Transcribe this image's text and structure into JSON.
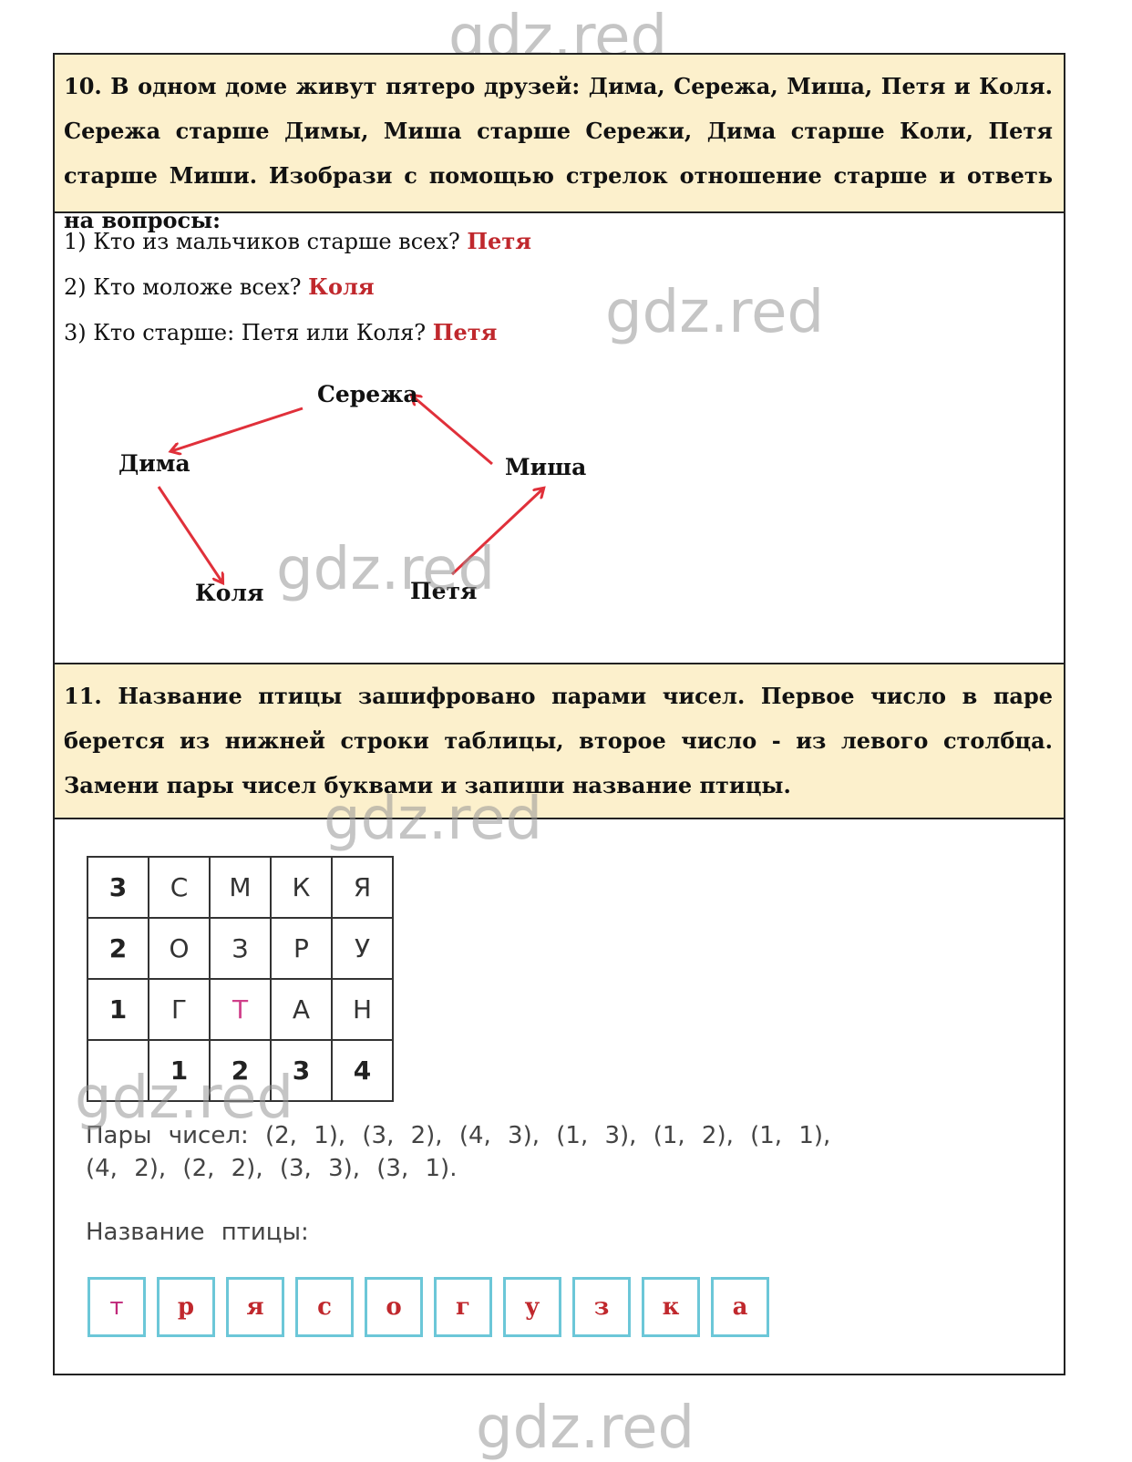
{
  "watermark": "gdz.red",
  "task10": {
    "text": "10. В одном доме живут пятеро друзей: Дима, Сережа, Миша, Петя и Коля. Сережа старше Димы, Миша старше Сережи, Дима старше Коли, Петя старше Миши. Изобрази с помощью стрелок отношение старше и ответь на вопросы:",
    "questions": [
      {
        "q": "1) Кто из мальчиков старше всех?",
        "a": "Петя"
      },
      {
        "q": "2) Кто моложе всех?",
        "a": "Коля"
      },
      {
        "q": "3) Кто старше: Петя или Коля?",
        "a": "Петя"
      }
    ],
    "diagram": {
      "nodes": [
        "Сережа",
        "Дима",
        "Миша",
        "Коля",
        "Петя"
      ],
      "arrow_color": "#e0303a",
      "edges": [
        [
          "Сережа",
          "Дима"
        ],
        [
          "Миша",
          "Сережа"
        ],
        [
          "Дима",
          "Коля"
        ],
        [
          "Петя",
          "Миша"
        ]
      ]
    }
  },
  "task11": {
    "text": "11. Название птицы зашифровано парами чисел. Первое число в паре берется из нижней строки таблицы, второе число - из левого столбца. Замени пары чисел буквами и запиши название птицы.",
    "table": [
      [
        "3",
        "С",
        "М",
        "К",
        "Я"
      ],
      [
        "2",
        "О",
        "З",
        "Р",
        "У"
      ],
      [
        "1",
        "Г",
        "Т",
        "А",
        "Н"
      ],
      [
        "",
        "1",
        "2",
        "3",
        "4"
      ]
    ],
    "pairs_line1": "Пары чисел: (2, 1), (3, 2), (4, 3), (1, 3), (1, 2), (1, 1),",
    "pairs_line2": "(4, 2), (2, 2), (3, 3), (3, 1).",
    "name_label": "Название птицы:",
    "answer": [
      "т",
      "р",
      "я",
      "с",
      "о",
      "г",
      "у",
      "з",
      "к",
      "а"
    ]
  }
}
